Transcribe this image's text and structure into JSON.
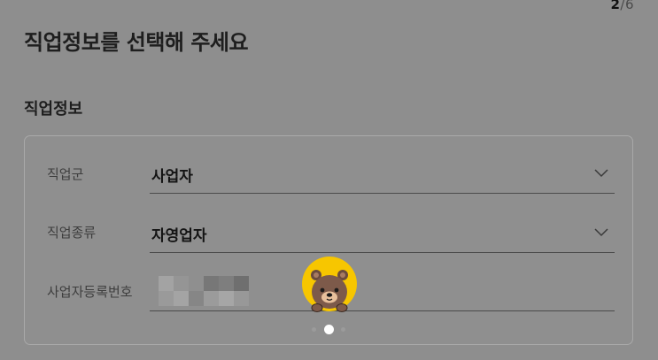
{
  "step_indicator": {
    "current": "2",
    "separator": "/",
    "total": "6"
  },
  "page_title": "직업정보를 선택해 주세요",
  "section_title": "직업정보",
  "fields": [
    {
      "label": "직업군",
      "value": "사업자"
    },
    {
      "label": "직업종류",
      "value": "자영업자"
    },
    {
      "label": "사업자등록번호",
      "value": ""
    }
  ],
  "icons": {
    "dropdown": "chevron-down-icon",
    "loading_mascot": "bear-icon",
    "masked_number": "pixelated-mosaic"
  },
  "colors": {
    "overlay_background": "#8e8e8e",
    "mascot_yellow": "#f7c600",
    "bear_brown": "#7d5a4a"
  },
  "pager": {
    "count": 3,
    "active_index": 1
  }
}
